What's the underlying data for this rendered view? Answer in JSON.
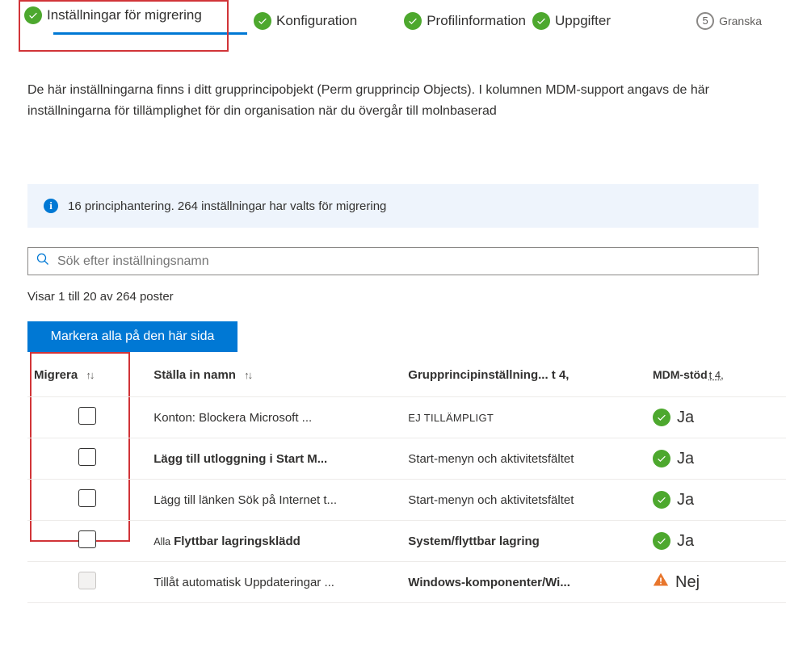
{
  "steps": {
    "s1": "Inställningar för migrering",
    "s2": "Konfiguration",
    "s3": "Profilinformation",
    "s4": "Uppgifter",
    "s5_num": "5",
    "s5": "Granska"
  },
  "description": "De här inställningarna finns i ditt grupprincipobjekt (Perm grupprincip Objects). I kolumnen MDM-support angavs de här inställningarna för tillämplighet för din organisation när du övergår till molnbaserad",
  "banner": {
    "count": "16",
    "text": "principhantering. 264 inställningar har valts för migrering"
  },
  "search": {
    "placeholder": "Sök efter inställningsnamn"
  },
  "status": "Visar 1 till 20 av 264 poster",
  "select_all": "Markera alla på den här sida",
  "headers": {
    "migrate": "Migrera",
    "name": "Ställa in namn",
    "gp": "Grupprincipinställning... t 4,",
    "mdm": "MDM-stöd",
    "mdm_sub": "t 4,"
  },
  "rows": [
    {
      "name": "Konton: Blockera Microsoft ...",
      "prefix": "",
      "bold": false,
      "gp": "EJ TILLÄMPLIGT",
      "gp_caps": true,
      "gp_bold": false,
      "mdm_ok": true,
      "mdm": "Ja",
      "disabled": false
    },
    {
      "name": "Lägg till utloggning i Start M...",
      "prefix": "",
      "bold": true,
      "gp": "Start-menyn och aktivitetsfältet",
      "gp_caps": false,
      "gp_bold": false,
      "mdm_ok": true,
      "mdm": "Ja",
      "disabled": false
    },
    {
      "name": "Lägg till länken Sök på Internet t...",
      "prefix": "",
      "bold": false,
      "gp": "Start-menyn och aktivitetsfältet",
      "gp_caps": false,
      "gp_bold": false,
      "mdm_ok": true,
      "mdm": "Ja",
      "disabled": false
    },
    {
      "name": "Flyttbar lagringsklädd",
      "prefix": "Alla",
      "bold": true,
      "gp": "System/flyttbar lagring",
      "gp_caps": false,
      "gp_bold": true,
      "mdm_ok": true,
      "mdm": "Ja",
      "disabled": false
    },
    {
      "name": "Tillåt automatisk Uppdateringar ...",
      "prefix": "",
      "bold": false,
      "gp": "Windows-komponenter/Wi...",
      "gp_caps": false,
      "gp_bold": true,
      "mdm_ok": false,
      "mdm": "Nej",
      "disabled": true
    }
  ]
}
